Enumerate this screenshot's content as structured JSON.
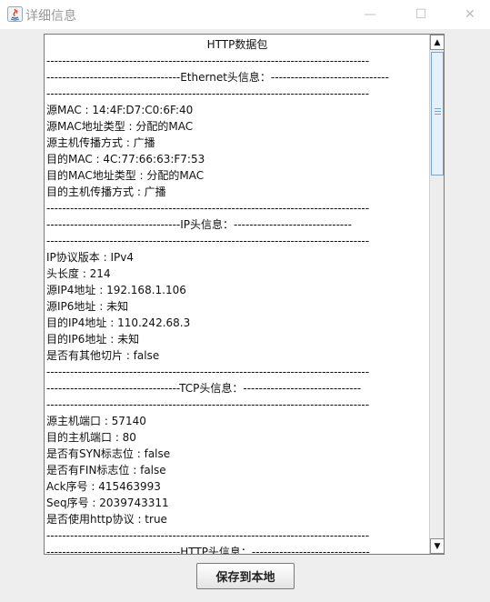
{
  "window": {
    "title": "详细信息",
    "min_glyph": "—",
    "max_glyph": "☐",
    "close_glyph": "✕"
  },
  "packet": {
    "lines": [
      {
        "text": "HTTP数据包",
        "align": "center"
      },
      {
        "text": "----------------------------------------------------------------------------------"
      },
      {
        "text": "----------------------------------Ethernet头信息：------------------------------"
      },
      {
        "text": "----------------------------------------------------------------------------------"
      },
      {
        "text": "源MAC : 14:4F:D7:C0:6F:40"
      },
      {
        "text": "源MAC地址类型 : 分配的MAC"
      },
      {
        "text": "源主机传播方式 : 广播"
      },
      {
        "text": "目的MAC : 4C:77:66:63:F7:53"
      },
      {
        "text": "目的MAC地址类型 : 分配的MAC"
      },
      {
        "text": "目的主机传播方式 : 广播"
      },
      {
        "text": "----------------------------------------------------------------------------------"
      },
      {
        "text": "----------------------------------IP头信息：------------------------------"
      },
      {
        "text": "----------------------------------------------------------------------------------"
      },
      {
        "text": "IP协议版本 : IPv4"
      },
      {
        "text": "头长度 : 214"
      },
      {
        "text": "源IP4地址 : 192.168.1.106"
      },
      {
        "text": "源IP6地址 : 未知"
      },
      {
        "text": "目的IP4地址 : 110.242.68.3"
      },
      {
        "text": "目的IP6地址 : 未知"
      },
      {
        "text": "是否有其他切片 : false"
      },
      {
        "text": "----------------------------------------------------------------------------------"
      },
      {
        "text": "----------------------------------TCP头信息：------------------------------"
      },
      {
        "text": "----------------------------------------------------------------------------------"
      },
      {
        "text": "源主机端口 : 57140"
      },
      {
        "text": "目的主机端口 : 80"
      },
      {
        "text": "是否有SYN标志位 : false"
      },
      {
        "text": "是否有FIN标志位 : false"
      },
      {
        "text": "Ack序号 : 415463993"
      },
      {
        "text": "Seq序号 : 2039743311"
      },
      {
        "text": "是否使用http协议 : true"
      },
      {
        "text": "----------------------------------------------------------------------------------"
      },
      {
        "text": "----------------------------------HTTP头信息：------------------------------"
      }
    ]
  },
  "scrollbar": {
    "up_glyph": "▲",
    "down_glyph": "▼"
  },
  "actions": {
    "save_label": "保存到本地"
  }
}
